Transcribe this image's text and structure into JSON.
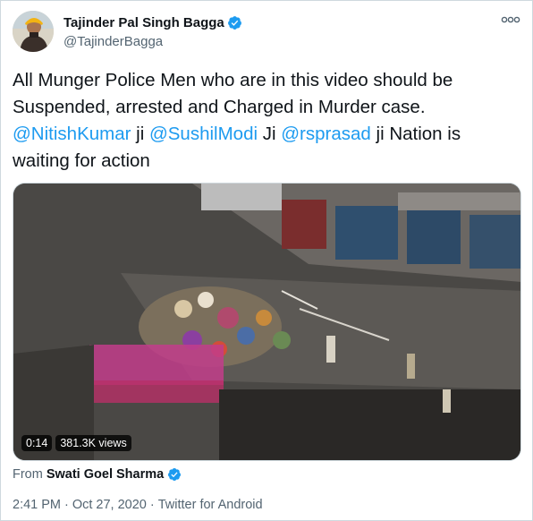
{
  "author": {
    "display_name": "Tajinder Pal Singh Bagga",
    "handle": "@TajinderBagga",
    "verified": true
  },
  "tweet": {
    "text_plain_1": "All Munger Police Men who are in this video should be Suspended, arrested and Charged in Murder case.",
    "mention_1": "@NitishKumar",
    "text_plain_2": " ji ",
    "mention_2": "@SushilModi",
    "text_plain_3": " Ji ",
    "mention_3": "@rsprasad",
    "text_plain_4": " ji Nation is waiting for action"
  },
  "media": {
    "duration": "0:14",
    "views": "381.3K views"
  },
  "attribution": {
    "from_label": "From",
    "from_name": "Swati Goel Sharma",
    "verified": true
  },
  "meta": {
    "time": "2:41 PM",
    "separator_1": "·",
    "date": "Oct 27, 2020",
    "separator_2": "·",
    "source": "Twitter for Android"
  },
  "colors": {
    "link": "#1d9bf0",
    "secondary_text": "#536471",
    "primary_text": "#0f1419",
    "verified_badge": "#1d9bf0"
  },
  "icons": {
    "more": "more-options-icon",
    "verified": "verified-badge-icon"
  }
}
